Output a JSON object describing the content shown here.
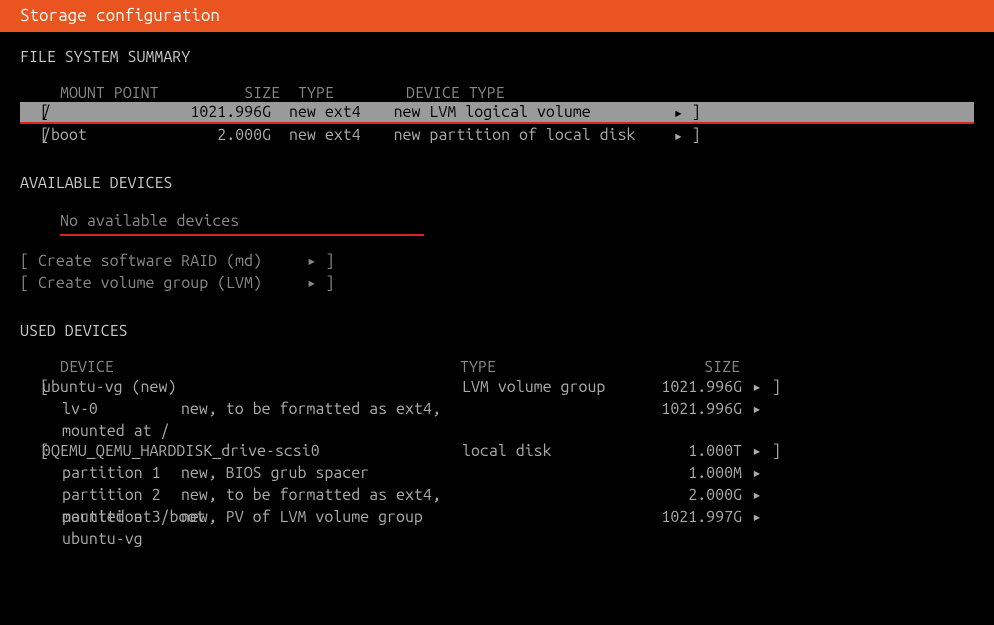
{
  "title": "Storage configuration",
  "fileSystemSummary": {
    "heading": "FILE SYSTEM SUMMARY",
    "columns": {
      "mount": "MOUNT POINT",
      "size": "SIZE",
      "type": "TYPE",
      "dtype": "DEVICE TYPE"
    },
    "rows": [
      {
        "mount": "/",
        "size": "1021.996G",
        "type": "new ext4",
        "dtype": "new LVM logical volume",
        "selected": true
      },
      {
        "mount": "/boot",
        "size": "2.000G",
        "type": "new ext4",
        "dtype": "new partition of local disk",
        "selected": false
      }
    ]
  },
  "availableDevices": {
    "heading": "AVAILABLE DEVICES",
    "none": "No available devices",
    "createRaid": "Create software RAID (md)",
    "createLvm": "Create volume group (LVM)"
  },
  "usedDevices": {
    "heading": "USED DEVICES",
    "columns": {
      "dev": "DEVICE",
      "type": "TYPE",
      "size": "SIZE"
    },
    "groups": [
      {
        "name": "ubuntu-vg (new)",
        "type": "LVM volume group",
        "size": "1021.996G",
        "children": [
          {
            "name": "lv-0",
            "desc": "new, to be formatted as ext4, mounted at /",
            "type": "",
            "size": "1021.996G"
          }
        ]
      },
      {
        "name": "0QEMU_QEMU_HARDDISK_drive-scsi0",
        "type": "local disk",
        "size": "1.000T",
        "children": [
          {
            "name": "partition 1",
            "desc": "new, BIOS grub spacer",
            "type": "",
            "size": "1.000M"
          },
          {
            "name": "partition 2",
            "desc": "new, to be formatted as ext4, mounted at /boot",
            "type": "",
            "size": "2.000G"
          },
          {
            "name": "partition 3",
            "desc": "new, PV of LVM volume group ubuntu-vg",
            "type": "",
            "size": "1021.997G"
          }
        ]
      }
    ]
  },
  "glyph": {
    "arrow": "▸",
    "brL": "[",
    "brR": "]"
  }
}
